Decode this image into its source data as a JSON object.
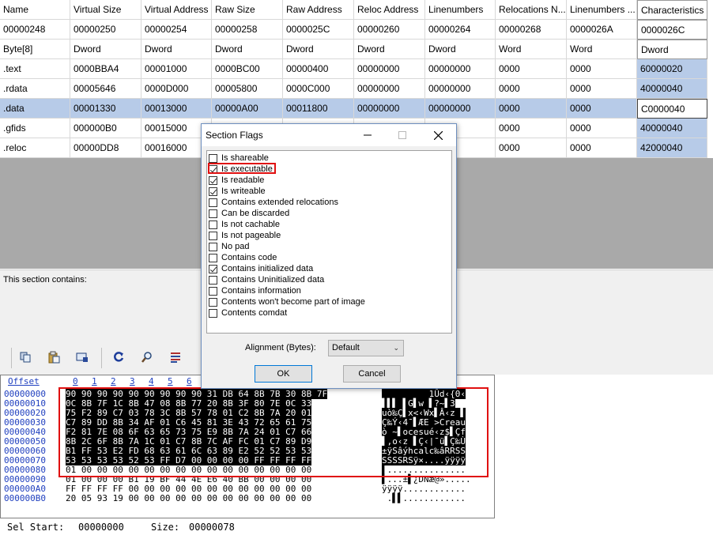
{
  "section_table": {
    "columns": [
      "Name",
      "Virtual Size",
      "Virtual Address",
      "Raw Size",
      "Raw Address",
      "Reloc Address",
      "Linenumbers",
      "Relocations N...",
      "Linenumbers ...",
      "Characteristics"
    ],
    "offsets": [
      "00000248",
      "00000250",
      "00000254",
      "00000258",
      "0000025C",
      "00000260",
      "00000264",
      "00000268",
      "0000026A",
      "0000026C"
    ],
    "types": [
      "Byte[8]",
      "Dword",
      "Dword",
      "Dword",
      "Dword",
      "Dword",
      "Dword",
      "Word",
      "Word",
      "Dword"
    ],
    "rows": [
      [
        ".text",
        "0000BBA4",
        "00001000",
        "0000BC00",
        "00000400",
        "00000000",
        "00000000",
        "0000",
        "0000",
        "60000020"
      ],
      [
        ".rdata",
        "00005646",
        "0000D000",
        "00005800",
        "0000C000",
        "00000000",
        "00000000",
        "0000",
        "0000",
        "40000040"
      ],
      [
        ".data",
        "00001330",
        "00013000",
        "00000A00",
        "00011800",
        "00000000",
        "00000000",
        "0000",
        "0000",
        "C0000040"
      ],
      [
        ".gfids",
        "000000B0",
        "00015000",
        "",
        "",
        "",
        "",
        "0000",
        "0000",
        "40000040"
      ],
      [
        ".reloc",
        "00000DD8",
        "00016000",
        "",
        "",
        "",
        "",
        "0000",
        "0000",
        "42000040"
      ]
    ],
    "selected_row": 2
  },
  "info_pane": {
    "label": "This section contains:"
  },
  "toolbar": {
    "icons": [
      "copy-icon",
      "paste-icon",
      "monitor-icon",
      "refresh-icon",
      "search-icon",
      "list-icon"
    ]
  },
  "hex_editor": {
    "offset_label": "Offset",
    "column_numbers": [
      "0",
      "1",
      "2",
      "3",
      "4",
      "5",
      "6"
    ],
    "offsets": [
      "00000000",
      "00000010",
      "00000020",
      "00000030",
      "00000040",
      "00000050",
      "00000060",
      "00000070",
      "00000080",
      "00000090",
      "000000A0",
      "000000B0"
    ],
    "bytes": [
      "90 90 90 90 90 90 90 90 90 31 DB 64 8B 7B 30 8B 7F",
      "0C 8B 7F 1C 8B 47 08 8B 77 20 8B 3F 80 7E 0C 33",
      "75 F2 89 C7 03 78 3C 8B 57 78 01 C2 8B 7A 20 01",
      "C7 89 DD 8B 34 AF 01 C6 45 81 3E 43 72 65 61 75",
      "F2 81 7E 08 6F 63 65 73 75 E9 8B 7A 24 01 C7 66",
      "8B 2C 6F 8B 7A 1C 01 C7 8B 7C AF FC 01 C7 89 D9",
      "B1 FF 53 E2 FD 68 63 61 6C 63 89 E2 52 52 53 53",
      "53 53 53 53 52 53 FF D7 00 00 00 00 FF FF FF FF",
      "01 00 00 00 00 00 00 00 00 00 00 00 00 00 00 00",
      "01 00 00 00 B1 19 BF 44 4E E6 40 BB 00 00 00 00",
      "FF FF FF FF 00 00 00 00 00 00 00 00 00 00 00 00",
      "20 05 93 19 00 00 00 00 00 00 00 00 00 00 00 00"
    ],
    "ascii": [
      "         1Ûd‹{0‹",
      "▌▌▌ ▌G▌w ▌?~▌3",
      "uò‰Ç▌x<‹Wx▌Â‹z ▌",
      "Ç‰Ý‹4¯▌ÆE >Creau",
      "ò ~▌ocesué‹z$▌Çf",
      "▌,o‹z ▌Ç‹|¯ü▌Ç‰Ù",
      "±ÿSâýhcalc‰âRRSS",
      "SSSSRSÿ×....ÿÿÿÿ",
      "▌...............",
      "▌...±▌¿DNæ@».....",
      "ÿÿÿÿ............",
      " .▌▌............"
    ],
    "selection_rows": 8
  },
  "status": {
    "sel_start_label": "Sel Start:",
    "sel_start_value": "00000000",
    "size_label": "Size:",
    "size_value": "00000078"
  },
  "dialog": {
    "title": "Section Flags",
    "flags": [
      {
        "label": "Is shareable",
        "checked": false
      },
      {
        "label": "Is executable",
        "checked": true
      },
      {
        "label": "Is readable",
        "checked": true
      },
      {
        "label": "Is writeable",
        "checked": true
      },
      {
        "label": "Contains extended relocations",
        "checked": false
      },
      {
        "label": "Can be discarded",
        "checked": false
      },
      {
        "label": "Is not cachable",
        "checked": false
      },
      {
        "label": "Is not pageable",
        "checked": false
      },
      {
        "label": "No pad",
        "checked": false
      },
      {
        "label": "Contains code",
        "checked": false
      },
      {
        "label": "Contains initialized data",
        "checked": true
      },
      {
        "label": "Contains Uninitialized data",
        "checked": false
      },
      {
        "label": "Contains information",
        "checked": false
      },
      {
        "label": "Contents won't become part of image",
        "checked": false
      },
      {
        "label": "Contents comdat",
        "checked": false
      }
    ],
    "alignment_label": "Alignment (Bytes):",
    "alignment_value": "Default",
    "ok_label": "OK",
    "cancel_label": "Cancel"
  },
  "colors": {
    "selection_blue": "#b7cbe8",
    "highlight_red": "#e01010",
    "hex_offset_blue": "#1f3fbf"
  }
}
